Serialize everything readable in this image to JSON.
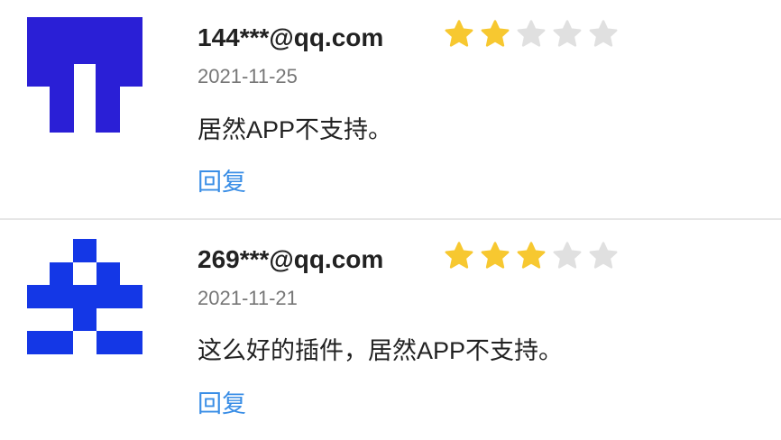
{
  "reviews": [
    {
      "username": "144***@qq.com",
      "rating": 2,
      "max_rating": 5,
      "date": "2021-11-25",
      "content": "居然APP不支持。",
      "reply_label": "回复",
      "avatar_color": "#2a1fd6",
      "avatar_icon": "identicon"
    },
    {
      "username": "269***@qq.com",
      "rating": 3,
      "max_rating": 5,
      "date": "2021-11-21",
      "content": "这么好的插件，居然APP不支持。",
      "reply_label": "回复",
      "avatar_color": "#1437e6",
      "avatar_icon": "identicon"
    }
  ],
  "colors": {
    "star_filled": "#f7c830",
    "star_empty": "#e0e0e0",
    "reply_link": "#3a8ee6",
    "divider": "#e6e6e6"
  }
}
